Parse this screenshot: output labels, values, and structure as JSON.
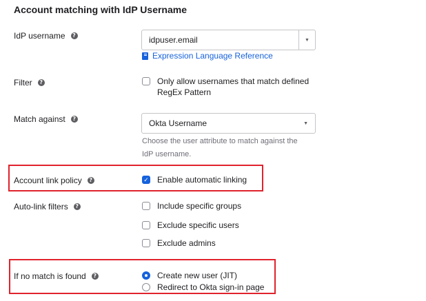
{
  "section": {
    "title": "Account matching with IdP Username"
  },
  "idp_username": {
    "label": "IdP username",
    "value": "idpuser.email",
    "link": "Expression Language Reference"
  },
  "filter": {
    "label": "Filter",
    "option_line1": "Only allow usernames that match defined",
    "option_line2": "RegEx Pattern",
    "checked": false
  },
  "match_against": {
    "label": "Match against",
    "selected": "Okta Username",
    "hint_line1": "Choose the user attribute to match against the",
    "hint_line2": "IdP username."
  },
  "account_link_policy": {
    "label": "Account link policy",
    "option": "Enable automatic linking",
    "checked": true
  },
  "auto_link_filters": {
    "label": "Auto-link filters",
    "options": [
      {
        "label": "Include specific groups",
        "checked": false
      },
      {
        "label": "Exclude specific users",
        "checked": false
      },
      {
        "label": "Exclude admins",
        "checked": false
      }
    ]
  },
  "no_match": {
    "label": "If no match is found",
    "options": [
      {
        "label": "Create new user (JIT)",
        "selected": true
      },
      {
        "label": "Redirect to Okta sign-in page",
        "selected": false
      }
    ]
  },
  "icons": {
    "help": "question-circle-icon",
    "book": "book-icon",
    "dropdown": "caret-down-icon",
    "check": "checkmark-icon"
  },
  "colors": {
    "accent": "#1662dd",
    "highlight": "#e0222c",
    "text": "#1d1d21",
    "hint": "#6e6e78"
  }
}
